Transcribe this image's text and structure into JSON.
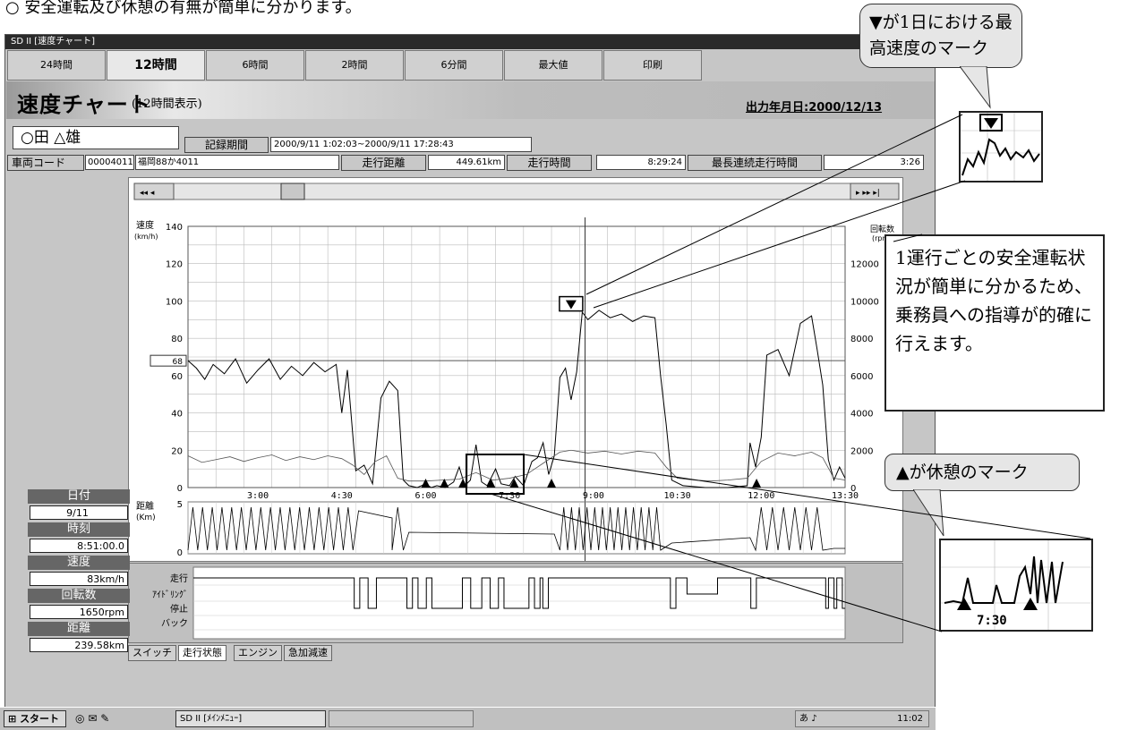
{
  "top_caption": "○ 安全運転及び休憩の有無が簡単に分かります。",
  "window": {
    "title": "SD II [速度チャート]",
    "toolbar": [
      "24時間",
      "12時間",
      "6時間",
      "2時間",
      "6分間",
      "最大値",
      "印刷"
    ],
    "active_toolbar_index": 1
  },
  "banner": {
    "title": "速度チャート",
    "subtitle": "(12時間表示)",
    "output_date": "出力年月日:2000/12/13"
  },
  "driver_name": "○田 △雄",
  "record": {
    "period_label": "記録期間",
    "period_value": "2000/9/11 1:02:03~2000/9/11 17:28:43",
    "vehicle_label": "車両コード",
    "vehicle_code": "00004011",
    "vehicle_plate": "福岡88か4011",
    "distance_label": "走行距離",
    "distance_value": "449.61km",
    "time_label": "走行時間",
    "time_value": "8:29:24",
    "max_cont_label": "最長連続走行時間",
    "max_cont_value": "3:26"
  },
  "chart_data": {
    "type": "line",
    "ylabel": "速度",
    "ylabel_unit": "(km/h)",
    "y2label": "回転数",
    "y2label_unit": "(rpm)",
    "ylim": [
      0,
      140
    ],
    "y2lim": [
      0,
      14000
    ],
    "yticks": [
      0,
      20,
      40,
      60,
      80,
      100,
      120,
      140
    ],
    "y2ticks": [
      0,
      2000,
      4000,
      6000,
      8000,
      10000,
      12000
    ],
    "xticks": [
      "3:00",
      "4:30",
      "6:00",
      "7:30",
      "9:00",
      "10:30",
      "12:00",
      "13:30"
    ],
    "xrange_hours": [
      1.75,
      13.5
    ],
    "cursor_time": "8:51:00",
    "threshold_marker": "68",
    "threshold_value": 68,
    "distance_label": "距離",
    "distance_unit": "(Km)",
    "distance_ticks": [
      0,
      5
    ],
    "max_speed_mark_time": "8:38",
    "rest_mark_times": [
      "6:00",
      "6:20",
      "6:40",
      "7:10",
      "7:35",
      "8:15",
      "11:55"
    ],
    "series": [
      {
        "name": "速度",
        "points": [
          [
            1.75,
            68
          ],
          [
            1.9,
            64
          ],
          [
            2.05,
            58
          ],
          [
            2.2,
            66
          ],
          [
            2.4,
            61
          ],
          [
            2.6,
            69
          ],
          [
            2.8,
            56
          ],
          [
            3.0,
            63
          ],
          [
            3.2,
            69
          ],
          [
            3.4,
            58
          ],
          [
            3.6,
            65
          ],
          [
            3.8,
            60
          ],
          [
            4.0,
            67
          ],
          [
            4.2,
            62
          ],
          [
            4.4,
            66
          ],
          [
            4.5,
            40
          ],
          [
            4.6,
            63
          ],
          [
            4.75,
            9
          ],
          [
            4.9,
            12
          ],
          [
            5.05,
            2
          ],
          [
            5.2,
            48
          ],
          [
            5.35,
            57
          ],
          [
            5.5,
            52
          ],
          [
            5.6,
            4
          ],
          [
            5.7,
            1
          ],
          [
            5.85,
            0
          ],
          [
            6.0,
            2
          ],
          [
            6.1,
            0
          ],
          [
            6.2,
            1
          ],
          [
            6.35,
            0
          ],
          [
            6.5,
            3
          ],
          [
            6.6,
            11
          ],
          [
            6.7,
            1
          ],
          [
            6.8,
            4
          ],
          [
            6.9,
            23
          ],
          [
            7.0,
            3
          ],
          [
            7.1,
            1
          ],
          [
            7.25,
            10
          ],
          [
            7.35,
            2
          ],
          [
            7.5,
            1
          ],
          [
            7.6,
            6
          ],
          [
            7.75,
            1
          ],
          [
            7.9,
            14
          ],
          [
            8.0,
            16
          ],
          [
            8.1,
            24
          ],
          [
            8.2,
            7
          ],
          [
            8.3,
            17
          ],
          [
            8.4,
            59
          ],
          [
            8.5,
            64
          ],
          [
            8.6,
            47
          ],
          [
            8.7,
            62
          ],
          [
            8.8,
            94
          ],
          [
            8.9,
            90
          ],
          [
            9.1,
            95
          ],
          [
            9.3,
            91
          ],
          [
            9.5,
            93
          ],
          [
            9.7,
            89
          ],
          [
            9.9,
            92
          ],
          [
            10.1,
            91
          ],
          [
            10.2,
            60
          ],
          [
            10.3,
            34
          ],
          [
            10.4,
            4
          ],
          [
            10.6,
            1
          ],
          [
            11.0,
            0
          ],
          [
            11.4,
            0
          ],
          [
            11.75,
            1
          ],
          [
            11.8,
            24
          ],
          [
            11.9,
            11
          ],
          [
            12.0,
            27
          ],
          [
            12.1,
            71
          ],
          [
            12.3,
            74
          ],
          [
            12.5,
            60
          ],
          [
            12.7,
            88
          ],
          [
            12.9,
            92
          ],
          [
            13.0,
            74
          ],
          [
            13.1,
            55
          ],
          [
            13.2,
            15
          ],
          [
            13.3,
            4
          ],
          [
            13.4,
            11
          ],
          [
            13.5,
            5
          ]
        ]
      },
      {
        "name": "回転数",
        "points": [
          [
            1.75,
            1700
          ],
          [
            2.0,
            1350
          ],
          [
            2.25,
            1500
          ],
          [
            2.5,
            1650
          ],
          [
            2.75,
            1400
          ],
          [
            3.0,
            1600
          ],
          [
            3.25,
            1750
          ],
          [
            3.5,
            1450
          ],
          [
            3.75,
            1650
          ],
          [
            4.0,
            1500
          ],
          [
            4.25,
            1700
          ],
          [
            4.5,
            1550
          ],
          [
            4.7,
            1200
          ],
          [
            4.9,
            700
          ],
          [
            5.1,
            1400
          ],
          [
            5.3,
            1700
          ],
          [
            5.5,
            500
          ],
          [
            5.7,
            350
          ],
          [
            6.0,
            350
          ],
          [
            6.3,
            400
          ],
          [
            6.6,
            450
          ],
          [
            6.9,
            800
          ],
          [
            7.2,
            400
          ],
          [
            7.5,
            500
          ],
          [
            7.8,
            700
          ],
          [
            8.1,
            1300
          ],
          [
            8.4,
            1900
          ],
          [
            8.6,
            2000
          ],
          [
            8.9,
            1850
          ],
          [
            9.2,
            1950
          ],
          [
            9.5,
            1800
          ],
          [
            9.8,
            1950
          ],
          [
            10.1,
            1850
          ],
          [
            10.3,
            1100
          ],
          [
            10.5,
            500
          ],
          [
            10.8,
            400
          ],
          [
            11.1,
            350
          ],
          [
            11.4,
            400
          ],
          [
            11.75,
            500
          ],
          [
            12.0,
            1400
          ],
          [
            12.3,
            1850
          ],
          [
            12.6,
            1700
          ],
          [
            12.9,
            1900
          ],
          [
            13.1,
            1600
          ],
          [
            13.3,
            500
          ],
          [
            13.5,
            400
          ]
        ]
      }
    ],
    "state_rows": [
      "走行",
      "ｱｲﾄﾞﾘﾝｸﾞ",
      "停止",
      "バック"
    ]
  },
  "side_panel": {
    "date_label": "日付",
    "date_value": "9/11",
    "time_label": "時刻",
    "time_value": "8:51:00.0",
    "speed_label": "速度",
    "speed_value": "83km/h",
    "rpm_label": "回転数",
    "rpm_value": "1650rpm",
    "dist_label": "距離",
    "dist_value": "239.58km"
  },
  "tabs": [
    "スイッチ",
    "走行状態",
    "エンジン",
    "急加減速"
  ],
  "active_tab_index": 1,
  "taskbar": {
    "start": "スタート",
    "task": "SD II [ﾒｲﾝﾒﾆｭｰ]",
    "tray": "あ",
    "clock": "11:02"
  },
  "callouts": {
    "max_mark_note": "▼が1日における最高速度のマーク",
    "guidance_note": "1運行ごとの安全運転状況が簡単に分かるため、乗務員への指導が的確に行えます。",
    "rest_mark_note": "▲が休憩のマーク",
    "zoom_time": "7:30"
  }
}
